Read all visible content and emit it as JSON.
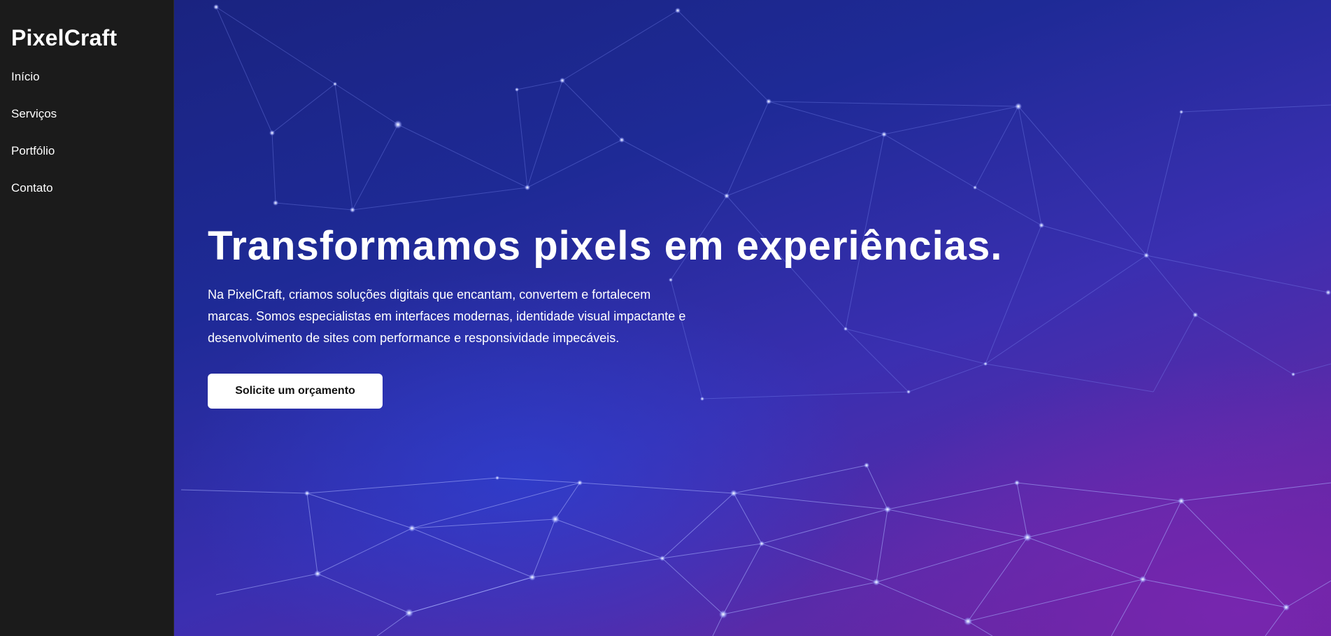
{
  "sidebar": {
    "brand": "PixelCraft",
    "nav": [
      {
        "label": "Início"
      },
      {
        "label": "Serviços"
      },
      {
        "label": "Portfólio"
      },
      {
        "label": "Contato"
      }
    ]
  },
  "hero": {
    "title": "Transformamos pixels em experiências.",
    "paragraph": "Na PixelCraft, criamos soluções digitais que encantam, convertem e fortalecem marcas. Somos especialistas em interfaces modernas, identidade visual impactante e desenvolvimento de sites com performance e responsividade impecáveis.",
    "cta_label": "Solicite um orçamento"
  },
  "colors": {
    "sidebar_bg": "#1b1b1b",
    "hero_gradient_start": "#1a2380",
    "hero_gradient_end": "#6a2398",
    "cta_bg": "#ffffff"
  }
}
